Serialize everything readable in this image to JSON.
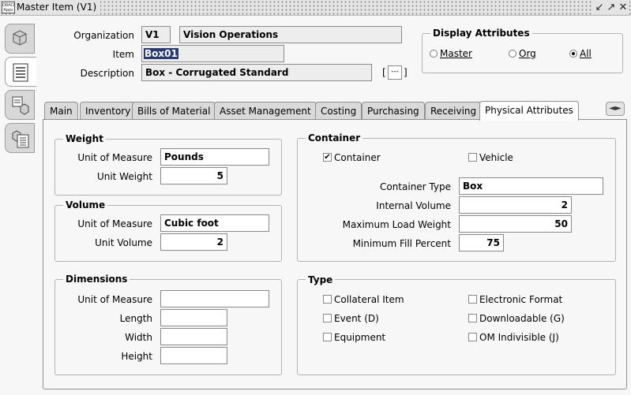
{
  "window": {
    "title": "Master Item (V1)",
    "icon_text": "ORACLE Apps",
    "controls": [
      "↙",
      "↗",
      "✕"
    ]
  },
  "header": {
    "organization_label": "Organization",
    "organization_code": "V1",
    "organization_name": "Vision Operations",
    "item_label": "Item",
    "item_value": "Box01",
    "description_label": "Description",
    "description_value": "Box - Corrugated Standard",
    "description_lov_left": "[",
    "description_lov_button": "---",
    "description_lov_right": "]"
  },
  "display_attributes": {
    "title": "Display Attributes",
    "options": [
      {
        "label": "Master",
        "mnemonic_index": 0,
        "selected": false
      },
      {
        "label": "Org",
        "mnemonic_index": 0,
        "selected": false
      },
      {
        "label": "All",
        "mnemonic_index": 0,
        "selected": true
      }
    ]
  },
  "sidebar": {
    "buttons": [
      {
        "icon": "cube-folder-icon",
        "active": false
      },
      {
        "icon": "list-document-icon",
        "active": true
      },
      {
        "icon": "item-relations-icon",
        "active": false
      },
      {
        "icon": "item-catalog-icon",
        "active": false
      }
    ]
  },
  "tabs": [
    {
      "label": "Main",
      "active": false
    },
    {
      "label": "Inventory",
      "active": false
    },
    {
      "label": "Bills of Material",
      "active": false
    },
    {
      "label": "Asset Management",
      "active": false
    },
    {
      "label": "Costing",
      "active": false
    },
    {
      "label": "Purchasing",
      "active": false
    },
    {
      "label": "Receiving",
      "active": false
    },
    {
      "label": "Physical Attributes",
      "active": true
    }
  ],
  "tab_scroll": "◄►",
  "weight": {
    "title": "Weight",
    "uom_label": "Unit of Measure",
    "uom_value": "Pounds",
    "unit_weight_label": "Unit Weight",
    "unit_weight_value": "5"
  },
  "volume": {
    "title": "Volume",
    "uom_label": "Unit of Measure",
    "uom_value": "Cubic foot",
    "unit_volume_label": "Unit Volume",
    "unit_volume_value": "2"
  },
  "dimensions": {
    "title": "Dimensions",
    "uom_label": "Unit of Measure",
    "uom_value": "",
    "length_label": "Length",
    "length_value": "",
    "width_label": "Width",
    "width_value": "",
    "height_label": "Height",
    "height_value": ""
  },
  "container": {
    "title": "Container",
    "container_check_label": "Container",
    "container_checked": true,
    "vehicle_check_label": "Vehicle",
    "vehicle_checked": false,
    "type_label": "Container Type",
    "type_value": "Box",
    "internal_volume_label": "Internal Volume",
    "internal_volume_value": "2",
    "max_load_label": "Maximum Load Weight",
    "max_load_value": "50",
    "min_fill_label": "Minimum Fill Percent",
    "min_fill_value": "75"
  },
  "type": {
    "title": "Type",
    "collateral_label": "Collateral Item",
    "electronic_label": "Electronic Format",
    "event_label": "Event (D)",
    "downloadable_label": "Downloadable (G)",
    "equipment_label": "Equipment",
    "om_indivisible_label": "OM Indivisible (J)"
  }
}
